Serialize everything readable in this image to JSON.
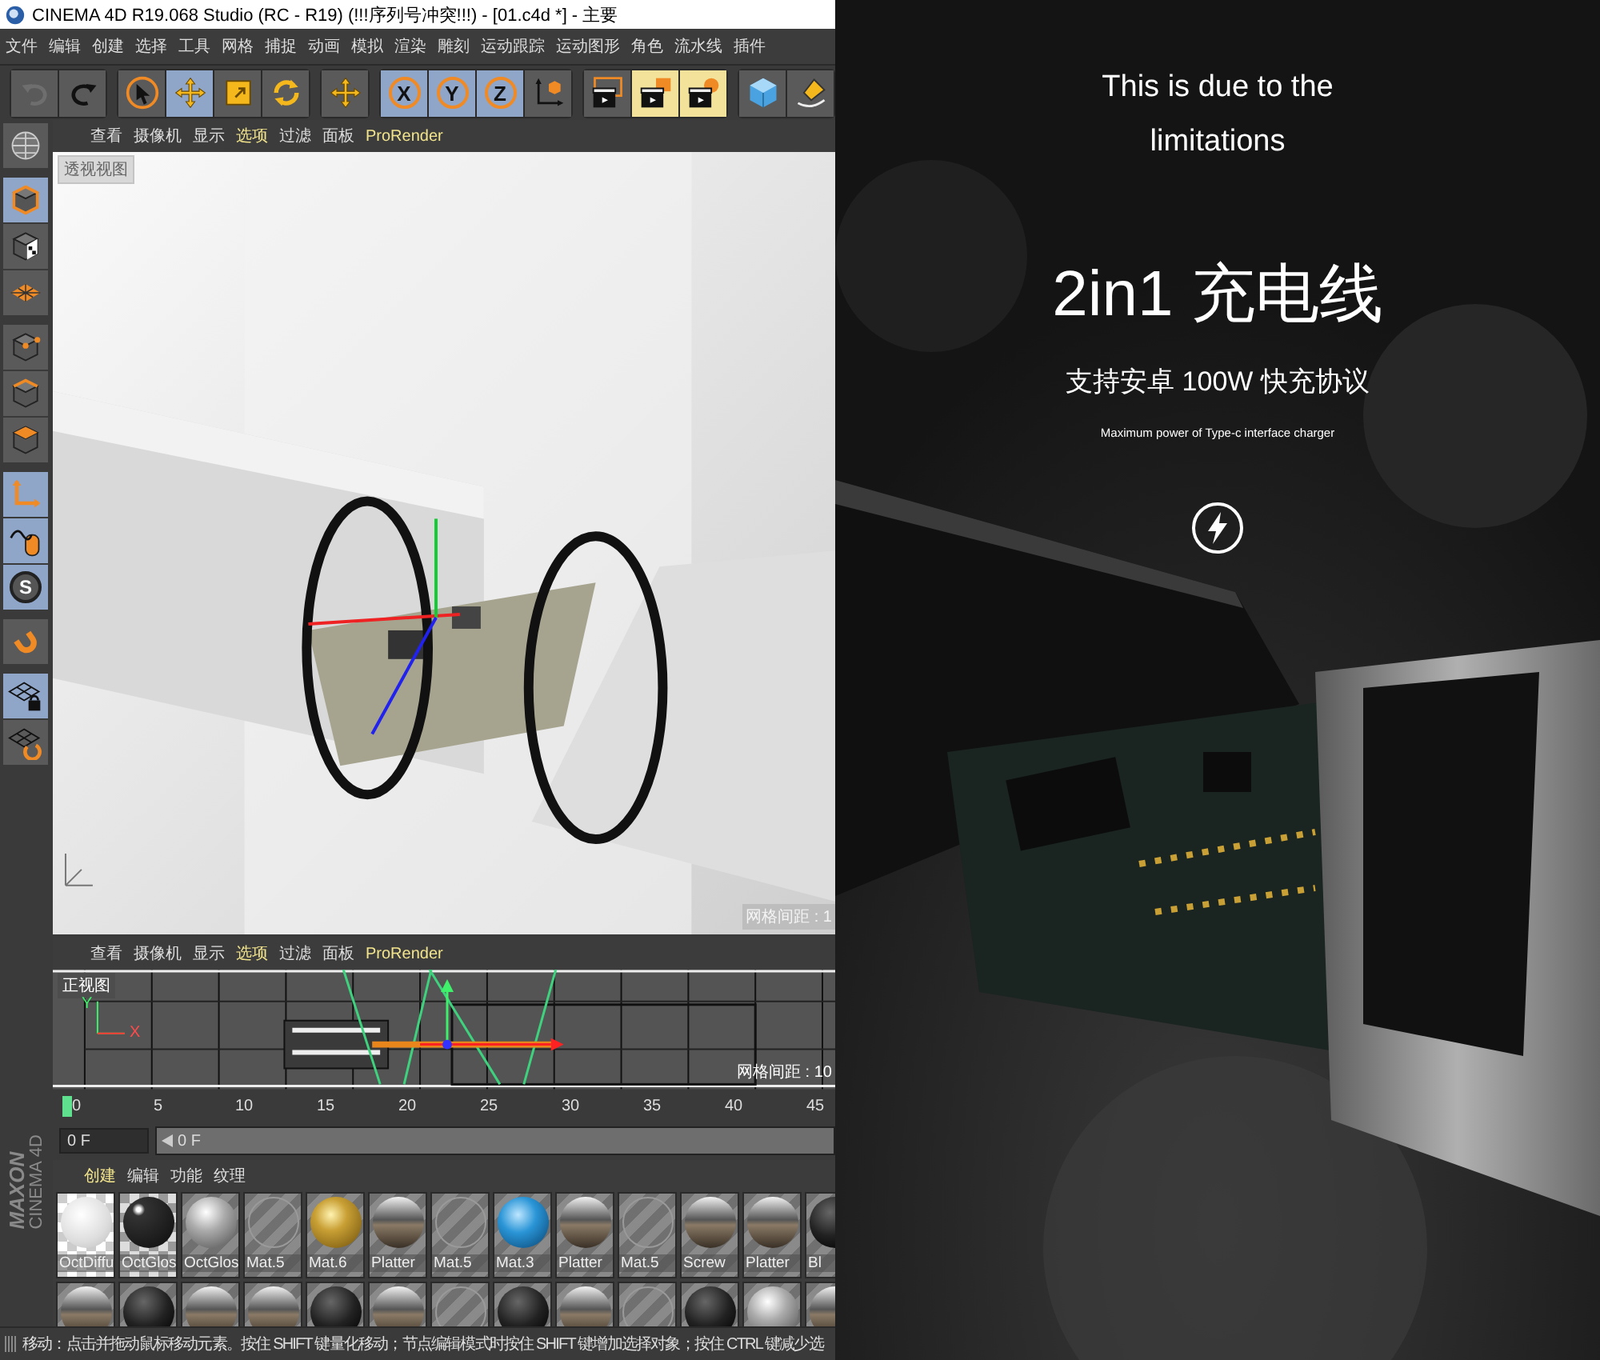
{
  "window": {
    "title": "CINEMA 4D R19.068 Studio (RC - R19) (!!!序列号冲突!!!) - [01.c4d *] - 主要"
  },
  "menu": [
    "文件",
    "编辑",
    "创建",
    "选择",
    "工具",
    "网格",
    "捕捉",
    "动画",
    "模拟",
    "渲染",
    "雕刻",
    "运动跟踪",
    "运动图形",
    "角色",
    "流水线",
    "插件"
  ],
  "toolbar": [
    {
      "items": [
        {
          "kind": "undo",
          "selected": false,
          "disabled": true
        },
        {
          "kind": "redo",
          "selected": false,
          "disabled": false
        }
      ]
    },
    {
      "items": [
        {
          "kind": "select",
          "selected": false,
          "disabled": false
        },
        {
          "kind": "move",
          "selected": true,
          "disabled": false
        },
        {
          "kind": "scale",
          "selected": false,
          "disabled": false
        },
        {
          "kind": "rotate",
          "selected": false,
          "disabled": false
        }
      ]
    },
    {
      "items": [
        {
          "kind": "cross",
          "selected": false,
          "disabled": false
        }
      ]
    },
    {
      "items": [
        {
          "kind": "axis",
          "label": "X",
          "selected": true,
          "disabled": false
        },
        {
          "kind": "axis",
          "label": "Y",
          "selected": true,
          "disabled": false
        },
        {
          "kind": "axis",
          "label": "Z",
          "selected": true,
          "disabled": false
        },
        {
          "kind": "coord",
          "selected": false,
          "disabled": false
        }
      ]
    },
    {
      "items": [
        {
          "kind": "render-view",
          "selected": false,
          "disabled": false
        },
        {
          "kind": "render",
          "selected": false,
          "disabled": false
        },
        {
          "kind": "render-settings",
          "selected": false,
          "disabled": false
        }
      ]
    },
    {
      "items": [
        {
          "kind": "cube",
          "selected": false,
          "disabled": false
        },
        {
          "kind": "pen",
          "selected": false,
          "disabled": false
        }
      ]
    }
  ],
  "side_toolbar": [
    {
      "items": [
        {
          "kind": "globe",
          "selected": false
        }
      ]
    },
    {
      "items": [
        {
          "kind": "model",
          "selected": true
        },
        {
          "kind": "texture",
          "selected": false
        },
        {
          "kind": "workplane",
          "selected": false
        }
      ]
    },
    {
      "items": [
        {
          "kind": "points",
          "selected": false
        },
        {
          "kind": "edges",
          "selected": false
        },
        {
          "kind": "polygons",
          "selected": false
        }
      ]
    },
    {
      "items": [
        {
          "kind": "axis-mode",
          "selected": true
        },
        {
          "kind": "tweak",
          "selected": true
        },
        {
          "kind": "snap",
          "label": "S",
          "selected": true
        }
      ]
    },
    {
      "items": [
        {
          "kind": "magnet",
          "selected": false
        }
      ]
    },
    {
      "items": [
        {
          "kind": "grid-lock",
          "selected": true
        },
        {
          "kind": "grid-refresh",
          "selected": false
        }
      ]
    }
  ],
  "viewports": [
    {
      "kind": "perspective",
      "menu": [
        {
          "label": "查看",
          "highlight": false
        },
        {
          "label": "摄像机",
          "highlight": false
        },
        {
          "label": "显示",
          "highlight": false
        },
        {
          "label": "选项",
          "highlight": true
        },
        {
          "label": "过滤",
          "highlight": false
        },
        {
          "label": "面板",
          "highlight": false
        },
        {
          "label": "ProRender",
          "highlight": true
        }
      ],
      "view_label": "透视视图",
      "grid_label": "网格间距 : 1"
    },
    {
      "kind": "front",
      "menu": [
        {
          "label": "查看",
          "highlight": false
        },
        {
          "label": "摄像机",
          "highlight": false
        },
        {
          "label": "显示",
          "highlight": false
        },
        {
          "label": "选项",
          "highlight": true
        },
        {
          "label": "过滤",
          "highlight": false
        },
        {
          "label": "面板",
          "highlight": false
        },
        {
          "label": "ProRender",
          "highlight": true
        }
      ],
      "view_label": "正视图",
      "grid_label": "网格间距 : 10",
      "axis_labels": [
        "Y",
        "X"
      ]
    }
  ],
  "timeline": {
    "ticks": [
      "0",
      "5",
      "10",
      "15",
      "20",
      "25",
      "30",
      "35",
      "40",
      "45"
    ],
    "frame_field": "0 F",
    "slider_value": "0 F",
    "level": 1
  },
  "materials": {
    "menu": [
      {
        "label": "创建",
        "highlight": true
      },
      {
        "label": "编辑",
        "highlight": false
      },
      {
        "label": "功能",
        "highlight": false
      },
      {
        "label": "纹理",
        "highlight": false
      }
    ],
    "rows": [
      [
        {
          "kind": "checker",
          "label": "OctDiffu"
        },
        {
          "kind": "dark",
          "label": "OctGlos"
        },
        {
          "kind": "silver",
          "label": "OctGlos"
        },
        {
          "kind": "hatch",
          "label": "Mat.5"
        },
        {
          "kind": "gold",
          "label": "Mat.6"
        },
        {
          "kind": "chrome",
          "label": "Platter"
        },
        {
          "kind": "hatch",
          "label": "Mat.5"
        },
        {
          "kind": "blue",
          "label": "Mat.3"
        },
        {
          "kind": "chrome",
          "label": "Platter"
        },
        {
          "kind": "hatch",
          "label": "Mat.5"
        },
        {
          "kind": "chrome",
          "label": "Screw"
        },
        {
          "kind": "chrome",
          "label": "Platter"
        },
        {
          "kind": "black",
          "label": "Bl"
        }
      ],
      [
        {
          "kind": "chrome"
        },
        {
          "kind": "black"
        },
        {
          "kind": "chrome"
        },
        {
          "kind": "chrome"
        },
        {
          "kind": "black"
        },
        {
          "kind": "chrome"
        },
        {
          "kind": "hatch"
        },
        {
          "kind": "black"
        },
        {
          "kind": "chrome"
        },
        {
          "kind": "hatch"
        },
        {
          "kind": "black"
        },
        {
          "kind": "silver"
        },
        {
          "kind": "chrome"
        }
      ]
    ]
  },
  "brand": {
    "line_1": "MAXON",
    "line_2": "CINEMA 4D"
  },
  "status_bar": "移动：点击并拖动鼠标移动元素。按住 SHIFT 键量化移动；节点编辑模式时按住 SHIFT 键增加选择对象；按住 CTRL 键减少选",
  "poster": {
    "subtitle": "This is due to the limitations",
    "title": "2in1 充电线",
    "tagline": "支持安卓 100W 快充协议",
    "caption": "Maximum power of Type-c interface charger"
  }
}
